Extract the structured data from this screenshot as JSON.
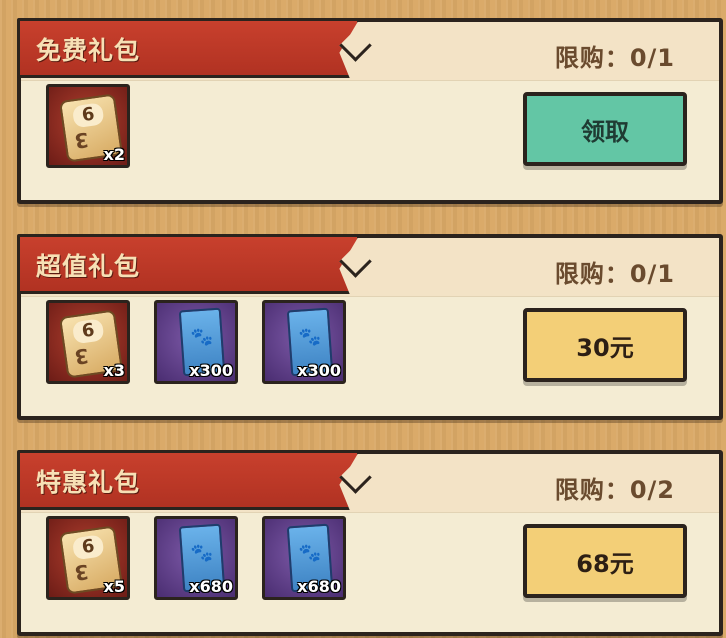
{
  "packs": [
    {
      "title": "免费礼包",
      "limit": "限购：0/1",
      "button": {
        "label": "领取",
        "style": "green"
      },
      "items": [
        {
          "type": "dice",
          "icon": "dice-icon",
          "quantity": "x2"
        }
      ]
    },
    {
      "title": "超值礼包",
      "limit": "限购：0/1",
      "button": {
        "label": "30元",
        "style": "gold"
      },
      "items": [
        {
          "type": "dice",
          "icon": "dice-icon",
          "quantity": "x3"
        },
        {
          "type": "card",
          "icon": "paw-card-icon",
          "quantity": "x300"
        },
        {
          "type": "card",
          "icon": "paw-card-icon",
          "quantity": "x300"
        }
      ]
    },
    {
      "title": "特惠礼包",
      "limit": "限购：0/2",
      "button": {
        "label": "68元",
        "style": "gold"
      },
      "items": [
        {
          "type": "dice",
          "icon": "dice-icon",
          "quantity": "x5"
        },
        {
          "type": "card",
          "icon": "paw-card-icon",
          "quantity": "x680"
        },
        {
          "type": "card",
          "icon": "paw-card-icon",
          "quantity": "x680"
        }
      ]
    }
  ],
  "colors": {
    "banner_red": "#c8402d",
    "free_button_green": "#63c6a5",
    "paid_button_gold": "#f3cf77",
    "panel_background": "#f4ecd3",
    "outline": "#2b231d"
  }
}
